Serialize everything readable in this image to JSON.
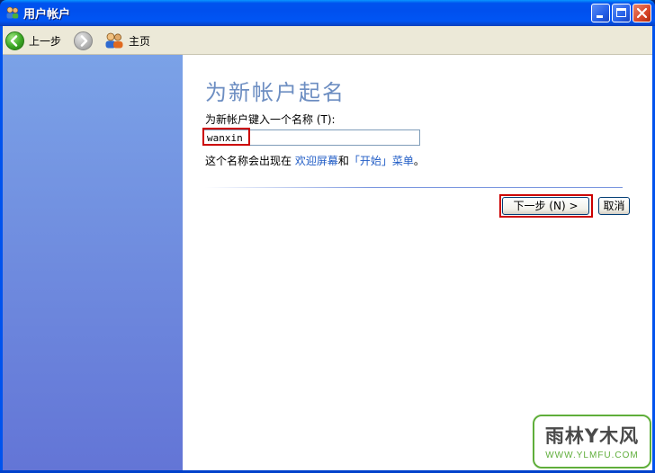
{
  "window": {
    "title": "用户帐户",
    "icon": "user-accounts-icon"
  },
  "titlebar_buttons": {
    "minimize": "minimize-icon",
    "maximize": "maximize-icon",
    "close": "close-icon"
  },
  "toolbar": {
    "back_label": "上一步",
    "forward_icon": "forward-arrow-icon",
    "home_label": "主页"
  },
  "main": {
    "heading": "为新帐户起名",
    "prompt": "为新帐户键入一个名称 (T):",
    "name_value": "wanxin",
    "note_prefix": "这个名称会出现在 ",
    "note_link_welcome": "欢迎屏幕",
    "note_and": "和",
    "note_link_start": "「开始」菜单",
    "note_suffix": "。",
    "next_button": "下一步 (N) >",
    "cancel_button": "取消"
  },
  "watermark": {
    "main": "雨林Y木风",
    "sub": "WWW.YLMFU.COM"
  },
  "colors": {
    "title_bar": "#0053ee",
    "sidebar_top": "#7ba2e7",
    "sidebar_bottom": "#6375d6",
    "heading": "#6d8ec2",
    "link": "#215dc6",
    "highlight": "#cc0000"
  }
}
